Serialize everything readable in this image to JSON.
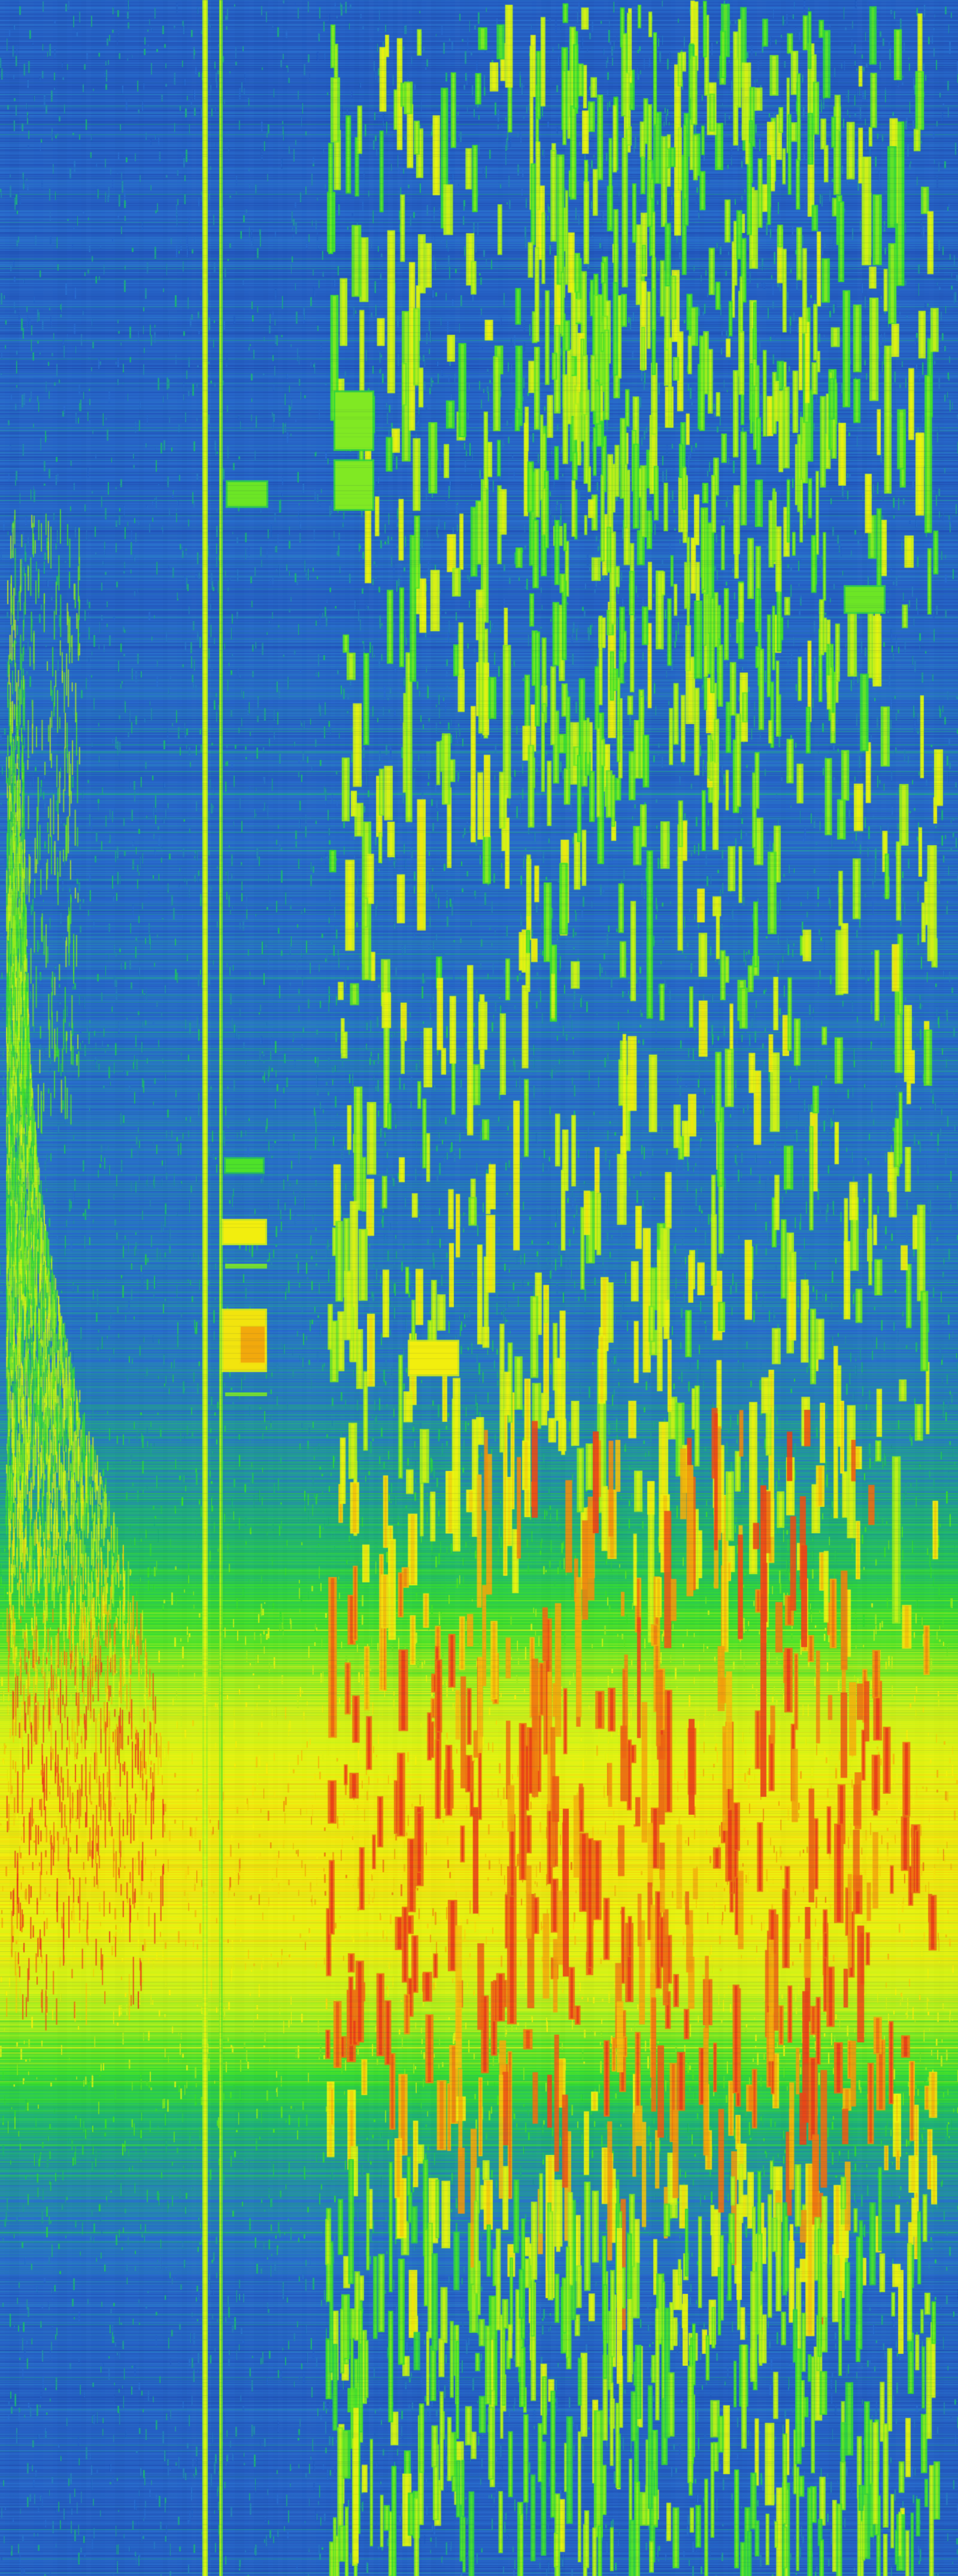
{
  "image": {
    "kind": "spectrogram-waterfall",
    "orientation": "vertical",
    "colormap": [
      "#1c3fa8",
      "#2a6fd0",
      "#1fb37a",
      "#39e02c",
      "#c8f21a",
      "#f2f20f",
      "#f2a60c",
      "#e8321a"
    ],
    "background_color": "#1c3fa8",
    "band_peak_color": "#f2f20f",
    "hot_color": "#e8321a",
    "labels": []
  }
}
